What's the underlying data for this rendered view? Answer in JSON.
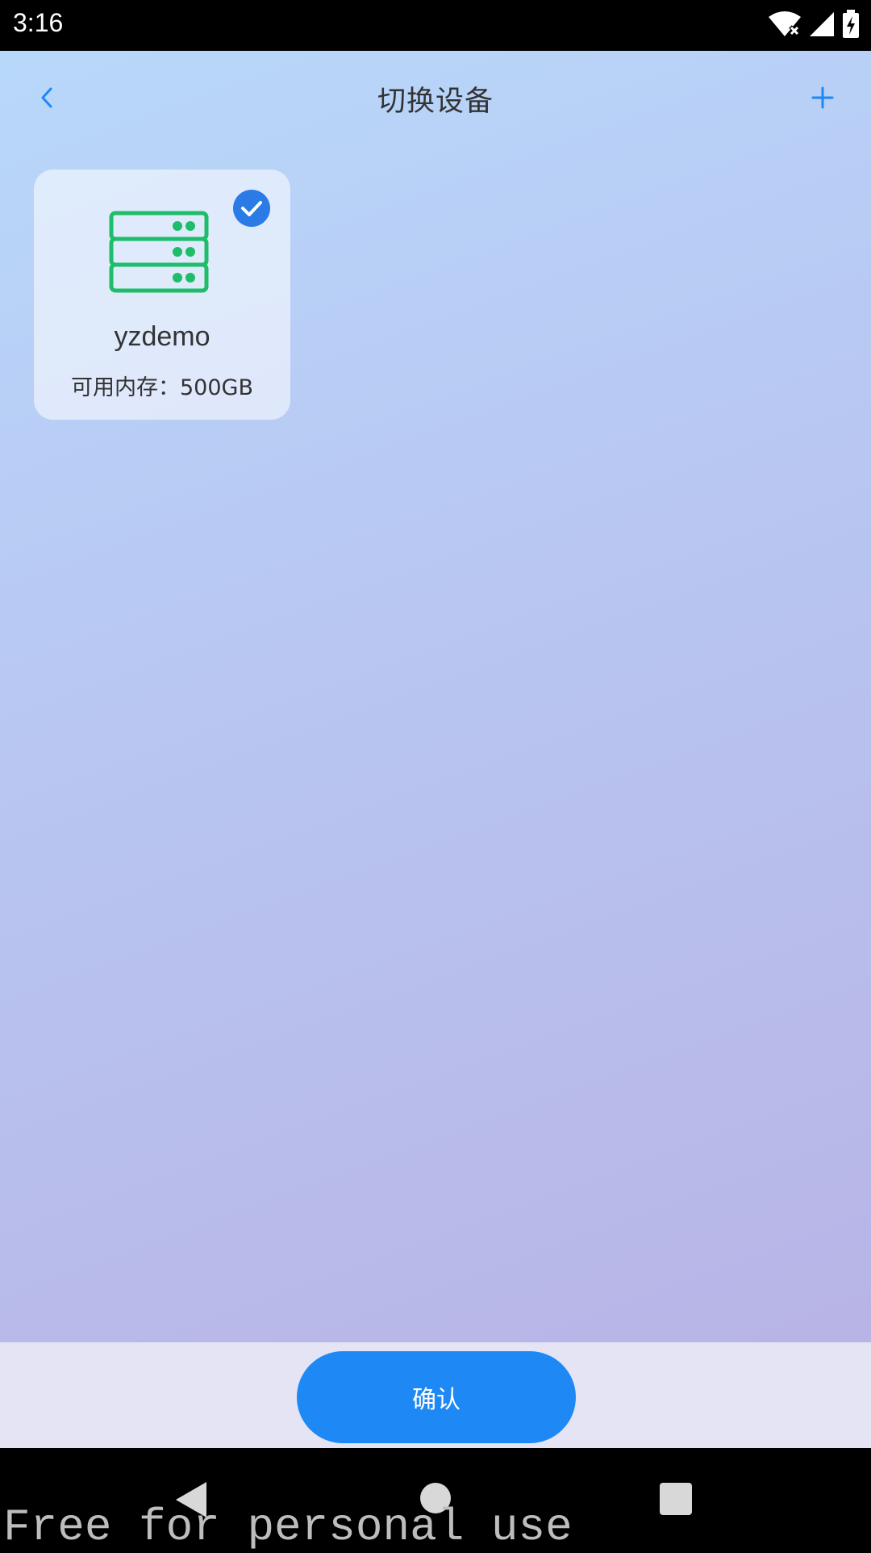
{
  "status_bar": {
    "time": "3:16",
    "icons": [
      "wifi-off-icon",
      "cellular-signal-icon",
      "battery-charging-icon"
    ]
  },
  "header": {
    "title": "切换设备",
    "back_icon": "chevron-left-icon",
    "add_icon": "plus-icon"
  },
  "devices": [
    {
      "name": "yzdemo",
      "storage": "可用内存：500GB",
      "selected": true,
      "icon": "server-icon"
    }
  ],
  "footer": {
    "confirm_label": "确认"
  },
  "navigation": {
    "back_icon": "nav-back-icon",
    "home_icon": "nav-home-icon",
    "recents_icon": "nav-recents-icon"
  },
  "watermark": "Free for personal use",
  "colors": {
    "accent": "#1e88f5",
    "server_green": "#1dbd6a",
    "check_badge": "#2b7be6"
  }
}
